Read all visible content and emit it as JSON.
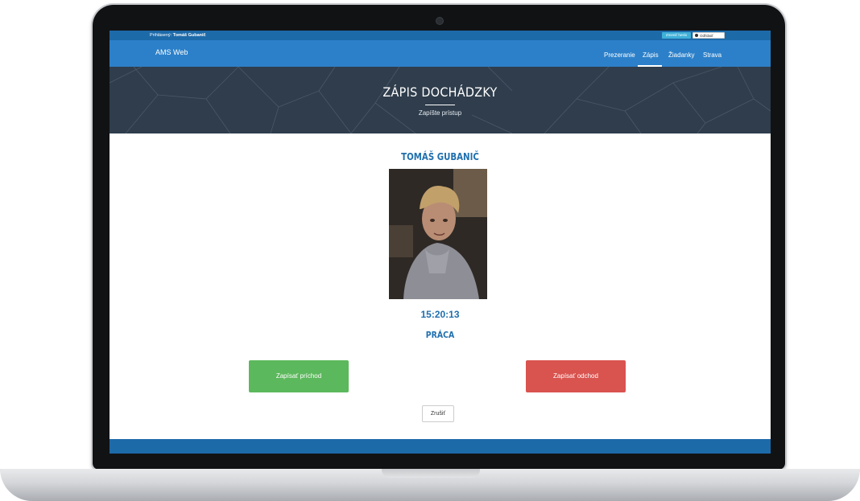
{
  "topbar": {
    "logged_prefix": "Prihlásený:",
    "logged_user": "Tomáš Gubanič",
    "change_label": "Zmeniť heslo",
    "logout_label": "Odhlásiť"
  },
  "navbar": {
    "brand": "AMS Web",
    "items": [
      {
        "label": "Prezeranie"
      },
      {
        "label": "Zápis"
      },
      {
        "label": "Žiadanky"
      },
      {
        "label": "Strava"
      }
    ],
    "active": "Zápis"
  },
  "hero": {
    "title": "ZÁPIS DOCHÁDZKY",
    "subtitle": "Zapíšte prístup"
  },
  "main": {
    "person_name": "TOMÁŠ GUBANIČ",
    "photo": "person-photo",
    "time": "15:20:13",
    "work_type": "PRÁCA",
    "arrival_label": "Zapísať príchod",
    "departure_label": "Zapísať odchod",
    "cancel_label": "Zrušiť"
  },
  "colors": {
    "primary": "#2c80c9",
    "dark_blue": "#1d6aa9",
    "hero_bg": "#2f3d4c",
    "success": "#5cb85c",
    "danger": "#d9534f",
    "text_blue": "#1f6fae"
  }
}
